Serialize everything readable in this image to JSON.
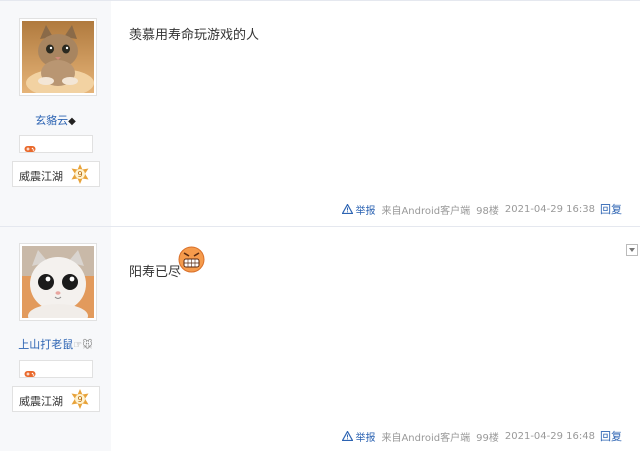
{
  "posts": [
    {
      "username": "玄貉云",
      "username_suffix_icon": "diamond-icon",
      "game_badge_icon": "gamepad-icon",
      "level_name": "威震江湖",
      "level_number": "9",
      "content": "羡慕用寿命玩游戏的人",
      "report_label": "举报",
      "source": "来自Android客户端",
      "floor": "98楼",
      "time": "2021-04-29 16:38",
      "reply_label": "回复",
      "avatar_icon": "cat-avatar"
    },
    {
      "username": "上山打老鼠",
      "username_suffix_icon": "hand-mouse-icon",
      "game_badge_icon": "gamepad-icon",
      "level_name": "威震江湖",
      "level_number": "9",
      "content": "阳寿已尽",
      "content_emoji": "grinning-angry-emoji",
      "report_label": "举报",
      "source": "来自Android客户端",
      "floor": "99楼",
      "time": "2021-04-29 16:48",
      "reply_label": "回复",
      "avatar_icon": "white-cat-avatar"
    }
  ],
  "colors": {
    "link": "#2d64b3",
    "meta": "#999999",
    "sidebar": "#f7f8fa",
    "level_star": "#e8a33a"
  }
}
